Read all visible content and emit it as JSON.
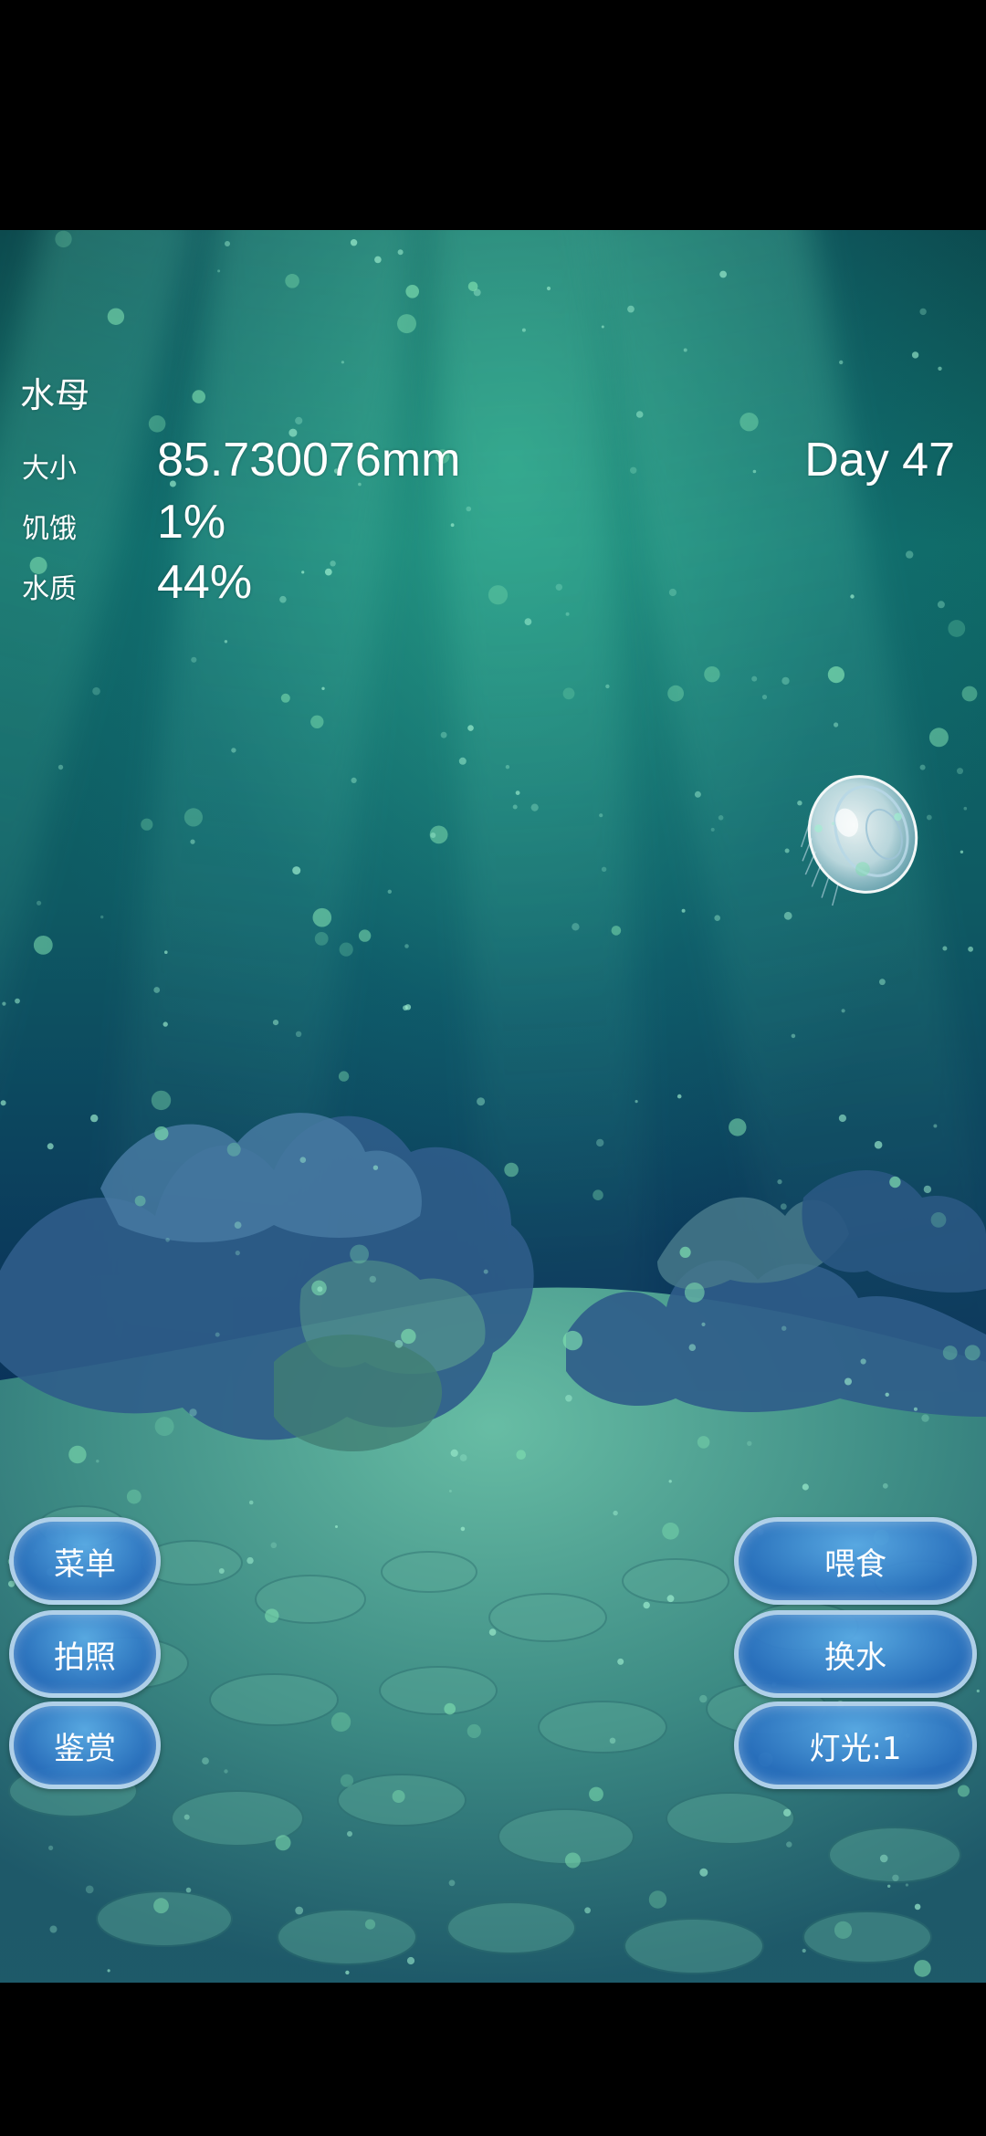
{
  "game": {
    "title": "水母",
    "day": "Day 47",
    "stats": {
      "size_label": "大小",
      "size_value": "85.730076mm",
      "hunger_label": "饥饿",
      "hunger_value": "1%",
      "water_label": "水质",
      "water_value": "44%"
    },
    "buttons": {
      "menu": "菜单",
      "photo": "拍照",
      "gallery": "鉴赏",
      "feed": "喂食",
      "change_water": "换水",
      "light": "灯光:1"
    }
  },
  "scene": {
    "creature": "jellyfish",
    "water_top_color": "#0f6a66",
    "water_deep_color": "#0a2c5a",
    "sand_color": "#3f8f86",
    "button_color": "#3c8ad0"
  }
}
